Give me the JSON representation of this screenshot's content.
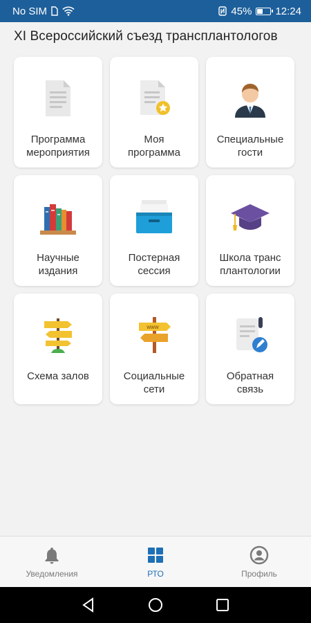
{
  "status_bar": {
    "carrier": "No SIM",
    "battery": "45%",
    "battery_level": 0.45,
    "time": "12:24"
  },
  "header": {
    "title": "XI Всероссийский съезд трансплантологов"
  },
  "tiles": [
    {
      "label": "Программа\nмероприятия",
      "icon": "document-icon"
    },
    {
      "label": "Моя\nпрограмма",
      "icon": "starred-document-icon"
    },
    {
      "label": "Специальные\nгости",
      "icon": "guest-person-icon"
    },
    {
      "label": "Научные\nиздания",
      "icon": "books-icon"
    },
    {
      "label": "Постерная\nсессия",
      "icon": "archive-box-icon"
    },
    {
      "label": "Школа транс\nплантологии",
      "icon": "graduation-cap-icon"
    },
    {
      "label": "Схема залов",
      "icon": "signpost-icon"
    },
    {
      "label": "Социальные\nсети",
      "icon": "www-signpost-icon"
    },
    {
      "label": "Обратная\nсвязь",
      "icon": "feedback-scroll-icon"
    }
  ],
  "bottom_nav": {
    "items": [
      {
        "label": "Уведомления",
        "icon": "bell-icon"
      },
      {
        "label": "РТО",
        "icon": "grid-icon"
      },
      {
        "label": "Профиль",
        "icon": "profile-icon"
      }
    ],
    "active_index": 1,
    "active_color": "#1e6fb5"
  },
  "colors": {
    "status_bar": "#1d5f9a",
    "background": "#f2f2f2"
  }
}
